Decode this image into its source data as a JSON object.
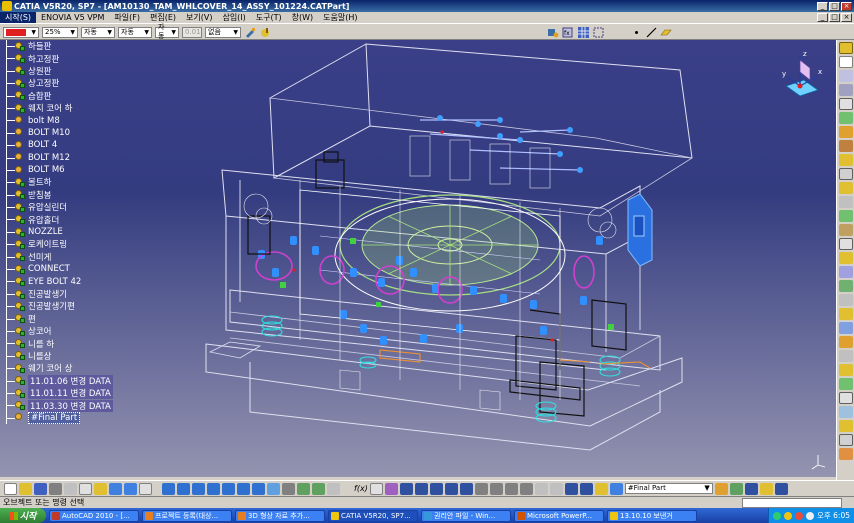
{
  "window": {
    "title": "CATIA V5R20, SP7 - [AM10130_TAM_WHLCOVER_14_ASSY_101224.CATPart]",
    "controls": [
      "_",
      "□",
      "×"
    ]
  },
  "menu": {
    "items": [
      "시작(S)",
      "ENOVIA V5 VPM",
      "파일(F)",
      "편집(E)",
      "보기(V)",
      "삽입(I)",
      "도구(T)",
      "창(W)",
      "도움말(H)"
    ],
    "active_index": 0,
    "mdi_controls": [
      "_",
      "□",
      "×"
    ]
  },
  "graphic_toolbar": {
    "color": "#e02020",
    "transparency": "25%",
    "thickness": "자동",
    "linetype": "자동",
    "point_style": "자동",
    "layer": "없음",
    "disabled_value": "0.01"
  },
  "spec_tree": {
    "items": [
      {
        "label": "하들판",
        "kind": "product"
      },
      {
        "label": "하고정판",
        "kind": "product"
      },
      {
        "label": "상원판",
        "kind": "product"
      },
      {
        "label": "상고정판",
        "kind": "product"
      },
      {
        "label": "습합판",
        "kind": "product"
      },
      {
        "label": "웨지 코어 하",
        "kind": "product"
      },
      {
        "label": "bolt M8",
        "kind": "part"
      },
      {
        "label": "BOLT M10",
        "kind": "part"
      },
      {
        "label": "BOLT 4",
        "kind": "part"
      },
      {
        "label": "BOLT M12",
        "kind": "part"
      },
      {
        "label": "BOLT M6",
        "kind": "part"
      },
      {
        "label": "볼트하",
        "kind": "product"
      },
      {
        "label": "받침봉",
        "kind": "product"
      },
      {
        "label": "유압실린더",
        "kind": "product"
      },
      {
        "label": "유압홀더",
        "kind": "product"
      },
      {
        "label": "NOZZLE",
        "kind": "product"
      },
      {
        "label": "로케이트링",
        "kind": "product"
      },
      {
        "label": "선미게",
        "kind": "product"
      },
      {
        "label": "CONNECT",
        "kind": "product"
      },
      {
        "label": "EYE BOLT 42",
        "kind": "product"
      },
      {
        "label": "진공발생기",
        "kind": "product"
      },
      {
        "label": "진공발생기편",
        "kind": "product"
      },
      {
        "label": "편",
        "kind": "product"
      },
      {
        "label": "상코어",
        "kind": "product"
      },
      {
        "label": "니를 하",
        "kind": "product"
      },
      {
        "label": "니를상",
        "kind": "product"
      },
      {
        "label": "웨기 코어 상",
        "kind": "product"
      },
      {
        "label": "11.01.06 변경 DATA",
        "kind": "product",
        "highlight": true
      },
      {
        "label": "11.01.11 변경 DATA",
        "kind": "product",
        "highlight": true
      },
      {
        "label": "11.03.30 변경 DATA",
        "kind": "product",
        "highlight": true
      },
      {
        "label": "#Final Part",
        "kind": "part",
        "selected": true
      }
    ]
  },
  "compass": {
    "axes": [
      "z",
      "y",
      "x"
    ]
  },
  "bottom_toolbar": {
    "part_selector": "#Final Part",
    "fps_label": "f(x)"
  },
  "status_bar": {
    "message": "오브젝트 또는 명령 선택"
  },
  "taskbar": {
    "start_label": "시작",
    "tasks": [
      {
        "label": "AutoCAD 2010 - [...",
        "color": "#c0392b"
      },
      {
        "label": "프로젝트 등록(대상...",
        "color": "#e67e22"
      },
      {
        "label": "3D 형상 자료 추가...",
        "color": "#e67e22"
      },
      {
        "label": "CATIA V5R20, SP7...",
        "color": "#f1c40f",
        "active": true
      },
      {
        "label": "권리안 파일 - Win...",
        "color": "#3498db"
      },
      {
        "label": "Microsoft PowerP...",
        "color": "#d35400"
      },
      {
        "label": "13.10.10 보낸거",
        "color": "#f1c40f"
      }
    ],
    "clock": "오후 6:05"
  }
}
